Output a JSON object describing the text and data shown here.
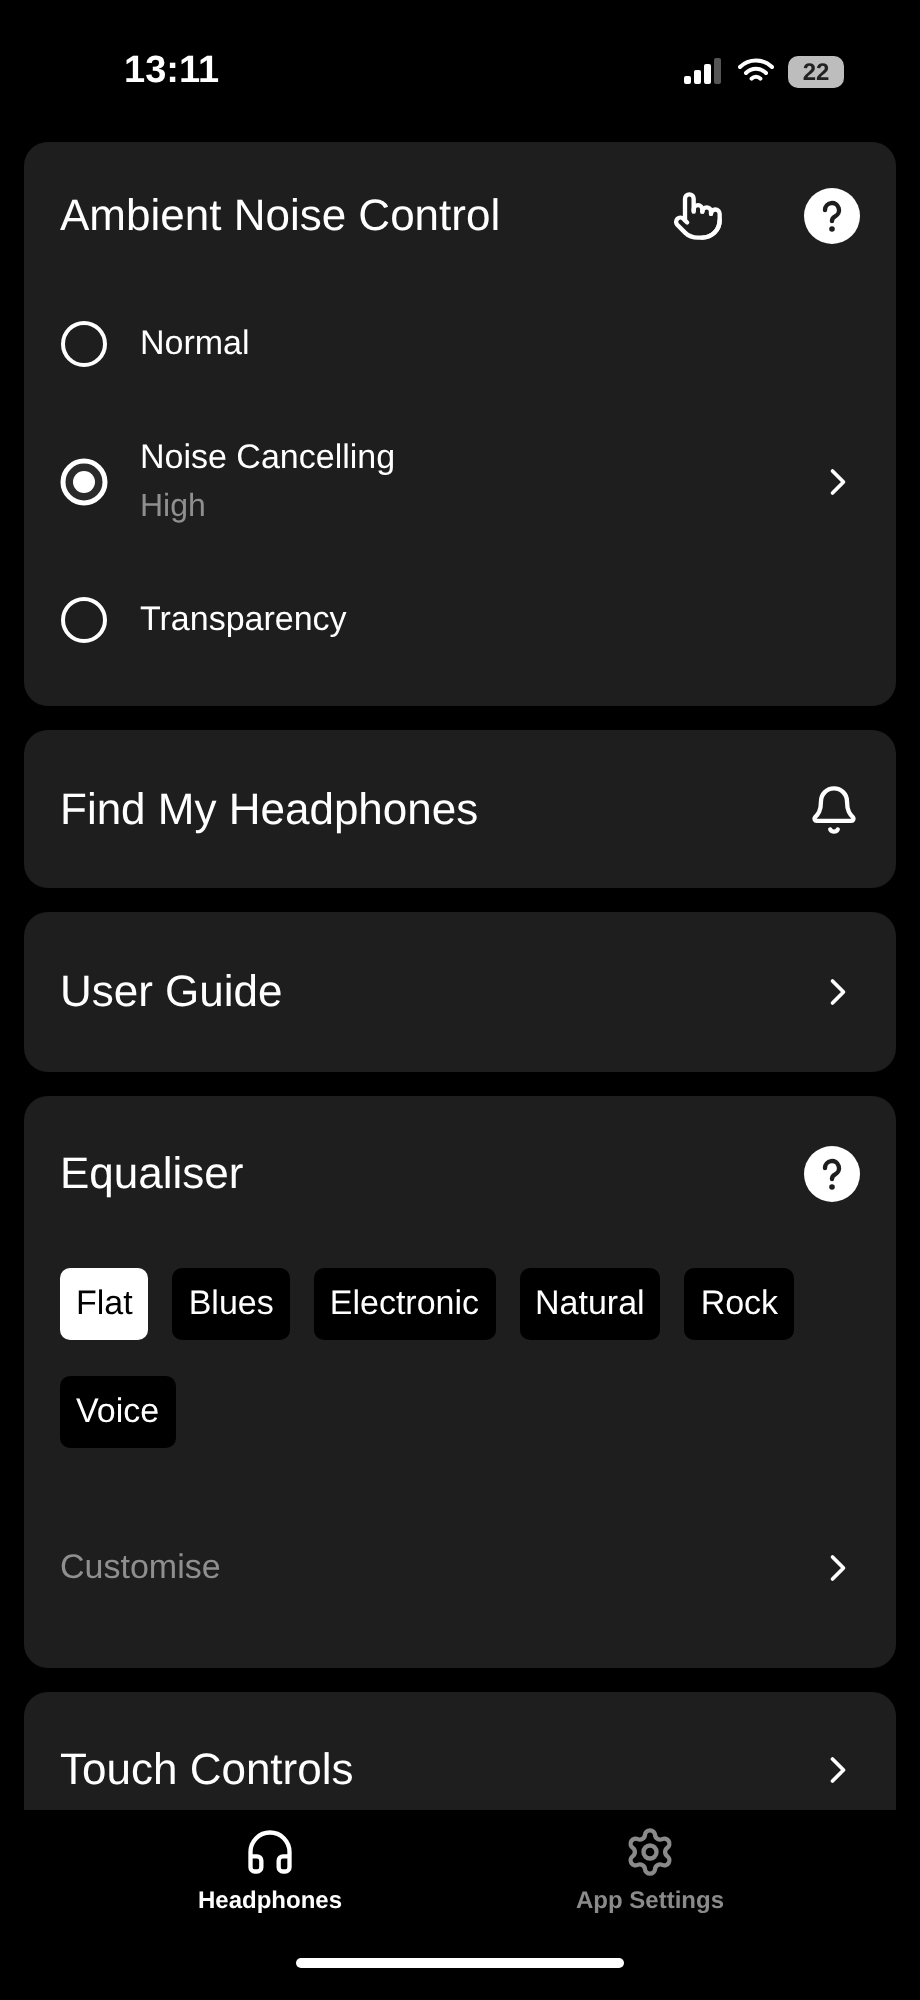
{
  "status_bar": {
    "time": "13:11",
    "battery": "22"
  },
  "ambient": {
    "title": "Ambient Noise Control",
    "options": [
      {
        "label": "Normal",
        "selected": false
      },
      {
        "label": "Noise Cancelling",
        "sublabel": "High",
        "selected": true
      },
      {
        "label": "Transparency",
        "selected": false
      }
    ]
  },
  "rows": [
    {
      "title": "Find My Headphones",
      "kind": "bell"
    },
    {
      "title": "User Guide",
      "kind": "chevron"
    }
  ],
  "equaliser": {
    "title": "Equaliser",
    "presets": [
      {
        "label": "Flat",
        "selected": true
      },
      {
        "label": "Blues",
        "selected": false
      },
      {
        "label": "Electronic",
        "selected": false
      },
      {
        "label": "Natural",
        "selected": false
      },
      {
        "label": "Rock",
        "selected": false
      },
      {
        "label": "Voice",
        "selected": false
      }
    ],
    "customise": "Customise"
  },
  "touch_controls": {
    "title": "Touch Controls"
  },
  "tab_bar": [
    {
      "label": "Headphones",
      "kind": "headphones",
      "selected": true
    },
    {
      "label": "App Settings",
      "kind": "settings",
      "selected": false
    }
  ]
}
